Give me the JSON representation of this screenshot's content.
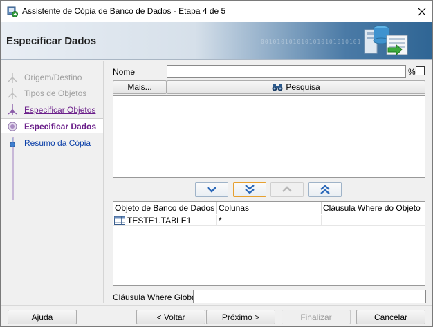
{
  "window": {
    "title": "Assistente de Cópia de Banco de Dados - Etapa 4 de 5",
    "close_glyph": "✕"
  },
  "header": {
    "title": "Especificar Dados",
    "binary_text": "0010101010101010101010101\n01010101"
  },
  "nav": {
    "steps": [
      {
        "label": "Origem/Destino",
        "state": "done"
      },
      {
        "label": "Tipos de Objetos",
        "state": "done"
      },
      {
        "label": "Especificar Objetos",
        "state": "visited"
      },
      {
        "label": "Especificar Dados",
        "state": "current"
      },
      {
        "label": "Resumo da Cópia",
        "state": "todo"
      }
    ]
  },
  "filter": {
    "name_label": "Nome",
    "name_value": "",
    "pct_label": "%",
    "more_button": "Mais...",
    "search_button": "Pesquisa"
  },
  "arrows": {
    "down": "down-arrow-icon",
    "down_all": "double-down-arrow-icon",
    "up": "up-arrow-icon",
    "up_all": "double-up-arrow-icon"
  },
  "table": {
    "columns": [
      "Objeto de Banco de Dados",
      "Colunas",
      "Cláusula Where do Objeto"
    ],
    "rows": [
      {
        "object": "TESTE1.TABLE1",
        "columns": "*",
        "where": ""
      }
    ]
  },
  "global_where": {
    "label": "Cláusula Where Global:",
    "value": ""
  },
  "footer": {
    "help": "Ajuda",
    "back": "< Voltar",
    "next": "Próximo >",
    "finish": "Finalizar",
    "cancel": "Cancelar"
  },
  "colors": {
    "visited_link": "#6b1f8a",
    "todo_link": "#0a3fa8",
    "header_gradient_end": "#2f6594"
  }
}
